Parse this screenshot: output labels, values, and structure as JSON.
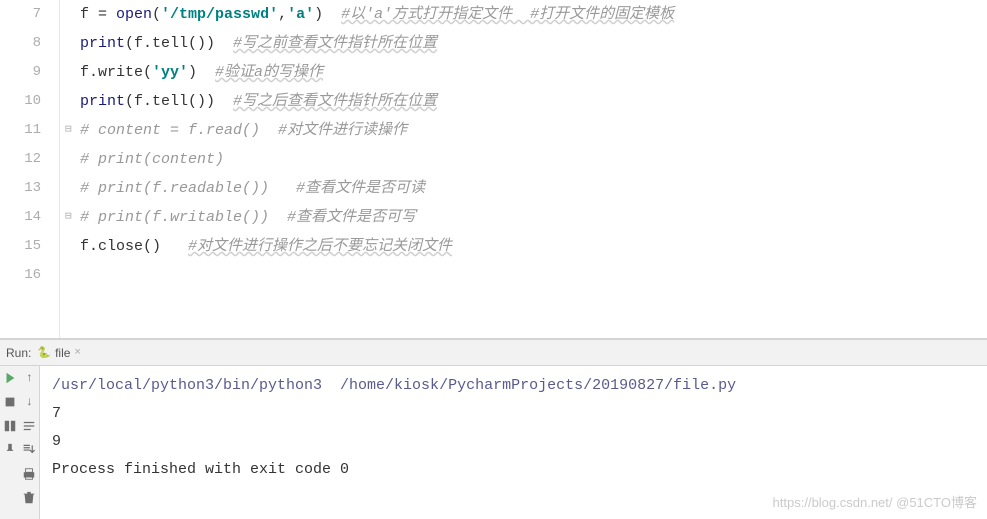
{
  "editor": {
    "lines": [
      {
        "num": "7",
        "fold": "",
        "tokens": [
          {
            "t": "f = ",
            "c": "tok-default"
          },
          {
            "t": "open",
            "c": "tok-builtin"
          },
          {
            "t": "(",
            "c": "tok-paren"
          },
          {
            "t": "'/tmp/passwd'",
            "c": "tok-string"
          },
          {
            "t": ",",
            "c": "tok-default"
          },
          {
            "t": "'a'",
            "c": "tok-string"
          },
          {
            "t": ")  ",
            "c": "tok-paren"
          },
          {
            "t": "#以'a'方式打开指定文件  #打开文件的固定模板",
            "c": "tok-comment comment-wave"
          }
        ]
      },
      {
        "num": "8",
        "fold": "",
        "tokens": [
          {
            "t": "print",
            "c": "tok-builtin"
          },
          {
            "t": "(f.tell())  ",
            "c": "tok-default"
          },
          {
            "t": "#写之前查看文件指针所在位置",
            "c": "tok-comment comment-wave"
          }
        ]
      },
      {
        "num": "9",
        "fold": "",
        "tokens": [
          {
            "t": "f.write(",
            "c": "tok-default"
          },
          {
            "t": "'yy'",
            "c": "tok-string"
          },
          {
            "t": ")  ",
            "c": "tok-default"
          },
          {
            "t": "#验证a的写操作",
            "c": "tok-comment comment-wave"
          }
        ]
      },
      {
        "num": "10",
        "fold": "",
        "tokens": [
          {
            "t": "print",
            "c": "tok-builtin"
          },
          {
            "t": "(f.tell())  ",
            "c": "tok-default"
          },
          {
            "t": "#写之后查看文件指针所在位置",
            "c": "tok-comment comment-wave"
          }
        ]
      },
      {
        "num": "11",
        "fold": "⊟",
        "tokens": [
          {
            "t": "# content = f.read()  #对文件进行读操作",
            "c": "tok-comment"
          }
        ]
      },
      {
        "num": "12",
        "fold": "",
        "tokens": [
          {
            "t": "# print(content)",
            "c": "tok-comment"
          }
        ]
      },
      {
        "num": "13",
        "fold": "",
        "tokens": [
          {
            "t": "# print(f.readable())   #查看文件是否可读",
            "c": "tok-comment"
          }
        ]
      },
      {
        "num": "14",
        "fold": "⊟",
        "tokens": [
          {
            "t": "# print(f.writable())  #查看文件是否可写",
            "c": "tok-comment"
          }
        ]
      },
      {
        "num": "15",
        "fold": "",
        "tokens": [
          {
            "t": "f.close()   ",
            "c": "tok-default"
          },
          {
            "t": "#对文件进行操作之后不要忘记关闭文件",
            "c": "tok-comment comment-wave"
          }
        ]
      },
      {
        "num": "16",
        "fold": "",
        "tokens": []
      }
    ]
  },
  "run": {
    "label": "Run:",
    "tab_name": "file",
    "output": {
      "path_line": "/usr/local/python3/bin/python3  /home/kiosk/PycharmProjects/20190827/file.py",
      "lines": [
        "7",
        "9",
        "",
        "Process finished with exit code 0"
      ]
    }
  },
  "watermark": "https://blog.csdn.net/ @51CTO博客"
}
